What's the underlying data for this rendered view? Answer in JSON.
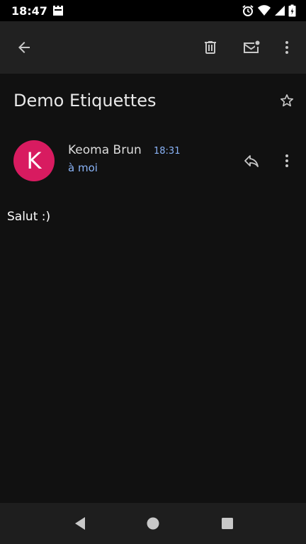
{
  "status_bar": {
    "time": "18:47",
    "icons": [
      "notification-icon",
      "alarm-icon",
      "wifi-icon",
      "signal-icon",
      "battery-icon"
    ]
  },
  "toolbar": {
    "icons": [
      "back-arrow-icon",
      "delete-icon",
      "mark-unread-icon",
      "more-vert-icon"
    ]
  },
  "email": {
    "subject": "Demo Etiquettes",
    "sender": {
      "name": "Keoma Brun",
      "initial": "K",
      "avatar_color": "#d81b60"
    },
    "time": "18:31",
    "recipient": "à moi",
    "body": "Salut :)"
  },
  "nav_bar": {
    "icons": [
      "back-triangle-icon",
      "home-circle-icon",
      "recents-square-icon"
    ]
  },
  "colors": {
    "background": "#111111",
    "appbar": "#212121",
    "accent_link": "#8ab4f8",
    "icon": "#c8c8c8"
  }
}
